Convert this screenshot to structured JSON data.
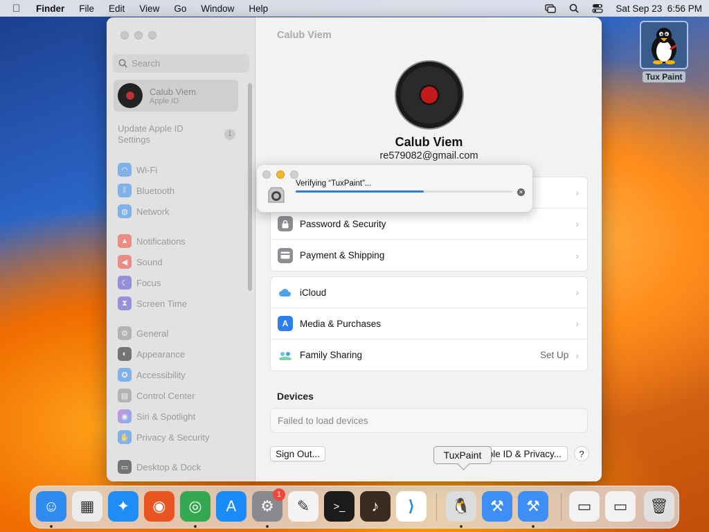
{
  "menubar": {
    "app_name": "Finder",
    "menus": [
      "File",
      "Edit",
      "View",
      "Go",
      "Window",
      "Help"
    ],
    "datetime": "Sat Sep 23  6:56 PM"
  },
  "desktop": {
    "icon_label": "Tux Paint"
  },
  "sidebar": {
    "search_placeholder": "Search",
    "account_name": "Calub Viem",
    "account_sub": "Apple ID",
    "update_label": "Update Apple ID Settings",
    "update_badge": "1",
    "items": [
      {
        "label": "Wi-Fi",
        "icon": "wifi-icon",
        "color": "#2d8cf0"
      },
      {
        "label": "Bluetooth",
        "icon": "bluetooth-icon",
        "color": "#2d8cf0"
      },
      {
        "label": "Network",
        "icon": "globe-icon",
        "color": "#2d8cf0"
      },
      {
        "label": "Notifications",
        "icon": "bell-icon",
        "color": "#f0463c"
      },
      {
        "label": "Sound",
        "icon": "speaker-icon",
        "color": "#f0463c"
      },
      {
        "label": "Focus",
        "icon": "moon-icon",
        "color": "#5b4fd8"
      },
      {
        "label": "Screen Time",
        "icon": "hourglass-icon",
        "color": "#5b4fd8"
      },
      {
        "label": "General",
        "icon": "gear-icon",
        "color": "#8e8e93"
      },
      {
        "label": "Appearance",
        "icon": "appearance-icon",
        "color": "#1c1c1e"
      },
      {
        "label": "Accessibility",
        "icon": "accessibility-icon",
        "color": "#2d8cf0"
      },
      {
        "label": "Control Center",
        "icon": "control-center-icon",
        "color": "#8e8e93"
      },
      {
        "label": "Siri & Spotlight",
        "icon": "siri-icon",
        "color": "#c04fd8"
      },
      {
        "label": "Privacy & Security",
        "icon": "hand-icon",
        "color": "#2d8cf0"
      },
      {
        "label": "Desktop & Dock",
        "icon": "dock-icon",
        "color": "#1c1c1e"
      }
    ]
  },
  "main": {
    "title": "Calub Viem",
    "profile_name": "Calub Viem",
    "profile_email": "re579082@gmail.com",
    "group1": [
      {
        "label": "Password & Security",
        "icon": "lock-icon",
        "color": "#8e8e93"
      },
      {
        "label": "Payment & Shipping",
        "icon": "card-icon",
        "color": "#8e8e93"
      }
    ],
    "group2": [
      {
        "label": "iCloud",
        "icon": "cloud-icon",
        "color": "#4aa3f0",
        "extra": ""
      },
      {
        "label": "Media & Purchases",
        "icon": "appstore-icon",
        "color": "#2d7ff0",
        "extra": ""
      },
      {
        "label": "Family Sharing",
        "icon": "family-icon",
        "color": "#6bc3f0",
        "extra": "Set Up"
      }
    ],
    "devices_title": "Devices",
    "devices_status": "Failed to load devices",
    "sign_out": "Sign Out...",
    "privacy_button": "ple ID & Privacy...",
    "help": "?"
  },
  "dialog": {
    "title": "Verifying “TuxPaint”...",
    "progress": 0.59
  },
  "tooltip": "TuxPaint",
  "dock": {
    "apps": [
      {
        "name": "finder-icon",
        "color": "#2f8bf0",
        "glyph": "☺"
      },
      {
        "name": "launchpad-icon",
        "color": "#ececec",
        "glyph": "▦"
      },
      {
        "name": "safari-icon",
        "color": "#1f8df5",
        "glyph": "✦"
      },
      {
        "name": "firefox-icon",
        "color": "#e95420",
        "glyph": "◉"
      },
      {
        "name": "chrome-icon",
        "color": "#34a853",
        "glyph": "◎"
      },
      {
        "name": "app-store-icon",
        "color": "#1a8cf7",
        "glyph": "A"
      },
      {
        "name": "system-settings-icon",
        "color": "#8a8a8e",
        "glyph": "⚙"
      },
      {
        "name": "textedit-icon",
        "color": "#f4f4f4",
        "glyph": "✎"
      },
      {
        "name": "terminal-icon",
        "color": "#1b1b1b",
        "glyph": ">_"
      },
      {
        "name": "garageband-icon",
        "color": "#3b2a20",
        "glyph": "♪"
      },
      {
        "name": "vscode-icon",
        "color": "#ffffff",
        "glyph": "⟩"
      },
      {
        "name": "tuxpaint-icon",
        "color": "#dcdcdc",
        "glyph": "🐧"
      },
      {
        "name": "xcode-icon",
        "color": "#3d8ff5",
        "glyph": "⚒"
      },
      {
        "name": "xcode-installer-icon",
        "color": "#3d8ff5",
        "glyph": "⚒"
      },
      {
        "name": "preview-window-icon",
        "color": "#f2f2f2",
        "glyph": "▭"
      },
      {
        "name": "chrome-window-icon",
        "color": "#f2f2f2",
        "glyph": "▭"
      },
      {
        "name": "trash-icon",
        "color": "#e0e0e0",
        "glyph": "🗑"
      }
    ],
    "badge": "1"
  }
}
